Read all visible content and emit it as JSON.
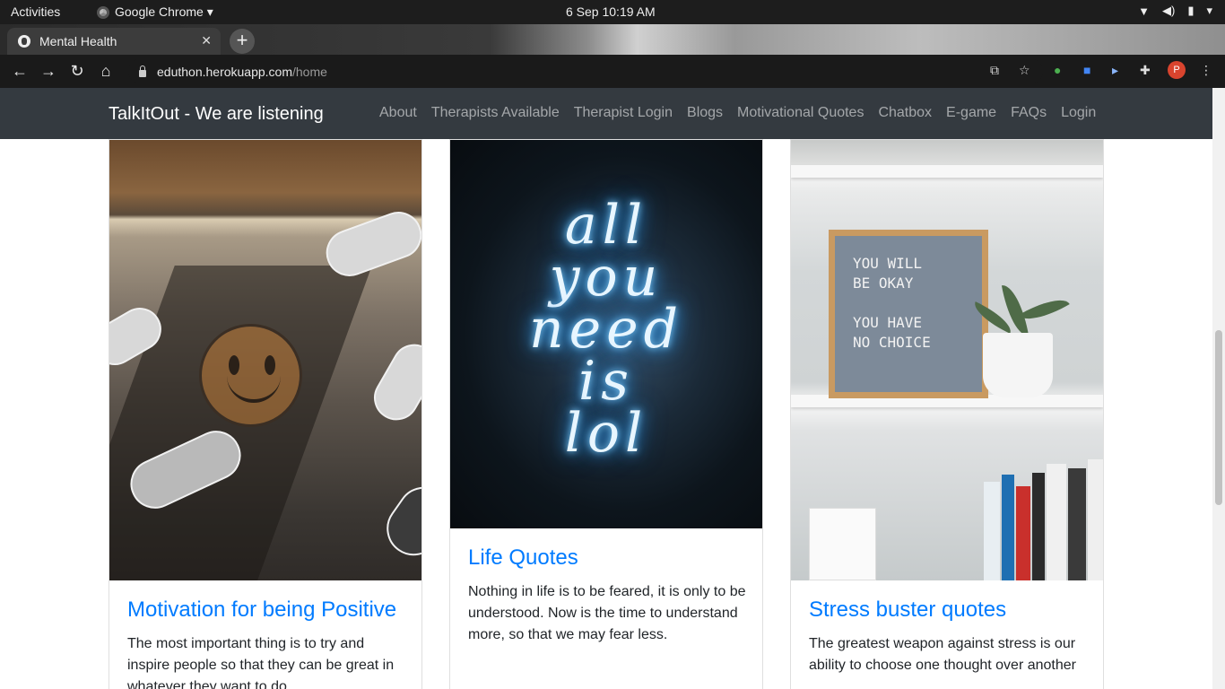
{
  "system_bar": {
    "activities": "Activities",
    "app_name": "Google Chrome ▾",
    "clock": "6 Sep  10:19 AM"
  },
  "browser": {
    "tab_title": "Mental Health",
    "tab_close": "✕",
    "new_tab": "+",
    "url_host": "eduthon.herokuapp.com",
    "url_path": "/home",
    "profile_initial": "P"
  },
  "site": {
    "brand": "TalkItOut - We are listening",
    "nav": [
      "About",
      "Therapists Available",
      "Therapist Login",
      "Blogs",
      "Motivational Quotes",
      "Chatbox",
      "E-game",
      "FAQs",
      "Login"
    ]
  },
  "cards": [
    {
      "title": "Motivation for being Positive",
      "text": "The most important thing is to try and inspire people so that they can be great in whatever they want to do."
    },
    {
      "title": "Life Quotes",
      "text": "Nothing in life is to be feared, it is only to be understood. Now is the time to understand more, so that we may fear less."
    },
    {
      "title": "Stress buster quotes",
      "text": "The greatest weapon against stress is our ability to choose one thought over another"
    }
  ],
  "images": {
    "neon_lines": [
      "all",
      "you",
      "need",
      "is",
      "lol"
    ],
    "letterboard_lines": [
      "YOU WILL",
      "BE OKAY",
      "",
      "YOU HAVE",
      "NO CHOICE"
    ]
  }
}
